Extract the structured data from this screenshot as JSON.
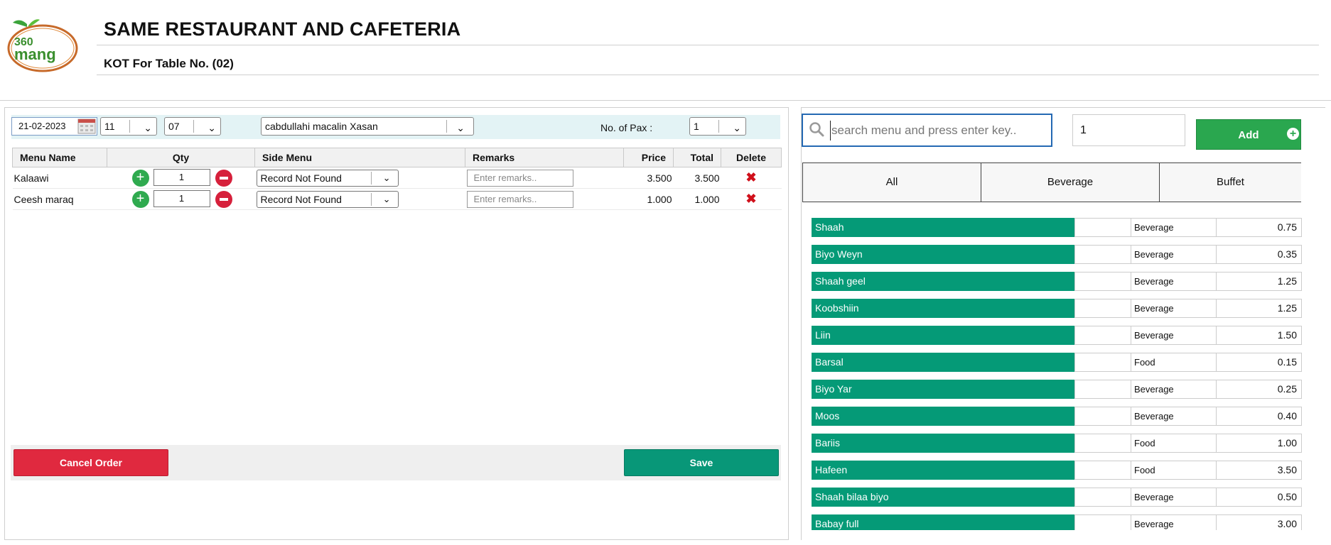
{
  "header": {
    "title": "SAME RESTAURANT AND CAFETERIA",
    "subtitle": "KOT For Table No. (02)",
    "logo_text": "360 mang"
  },
  "filters": {
    "date": "21-02-2023",
    "hour": "11",
    "minute": "07",
    "waiter": "cabdullahi macalin Xasan",
    "pax_label": "No. of Pax :",
    "pax_value": "1"
  },
  "order_table": {
    "headers": [
      "Menu Name",
      "Qty",
      "Side Menu",
      "Remarks",
      "Price",
      "Total",
      "Delete"
    ],
    "rows": [
      {
        "name": "Kalaawi",
        "qty": "1",
        "side": "Record Not Found",
        "remarks_placeholder": "Enter remarks..",
        "price": "3.500",
        "total": "3.500"
      },
      {
        "name": "Ceesh maraq",
        "qty": "1",
        "side": "Record Not Found",
        "remarks_placeholder": "Enter remarks..",
        "price": "1.000",
        "total": "1.000"
      }
    ]
  },
  "actions": {
    "cancel_label": "Cancel Order",
    "save_label": "Save"
  },
  "menu_panel": {
    "search_placeholder": "search menu and press enter key..",
    "quantity": "1",
    "add_label": "Add",
    "categories": [
      "All",
      "Beverage",
      "Buffet"
    ],
    "items": [
      {
        "name": "Shaah",
        "category": "Beverage",
        "price": "0.75"
      },
      {
        "name": "Biyo Weyn",
        "category": "Beverage",
        "price": "0.35"
      },
      {
        "name": "Shaah geel",
        "category": "Beverage",
        "price": "1.25"
      },
      {
        "name": "Koobshiin",
        "category": "Beverage",
        "price": "1.25"
      },
      {
        "name": "Liin",
        "category": "Beverage",
        "price": "1.50"
      },
      {
        "name": "Barsal",
        "category": "Food",
        "price": "0.15"
      },
      {
        "name": "Biyo Yar",
        "category": "Beverage",
        "price": "0.25"
      },
      {
        "name": "Moos",
        "category": "Beverage",
        "price": "0.40"
      },
      {
        "name": "Bariis",
        "category": "Food",
        "price": "1.00"
      },
      {
        "name": "Hafeen",
        "category": "Food",
        "price": "3.50"
      },
      {
        "name": "Shaah bilaa biyo",
        "category": "Beverage",
        "price": "0.50"
      },
      {
        "name": "Babay full",
        "category": "Beverage",
        "price": "3.00"
      }
    ]
  },
  "colors": {
    "item_green": "#059a77",
    "add_green": "#2aa74f",
    "cancel_red": "#e0293f",
    "save_teal": "#089778",
    "filter_bg": "#e3f3f5"
  }
}
